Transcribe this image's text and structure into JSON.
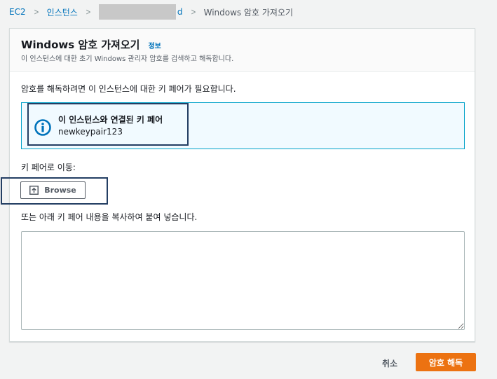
{
  "breadcrumb": {
    "items": [
      "EC2",
      "인스턴스"
    ],
    "redacted_tail": "d",
    "current": "Windows 암호 가져오기"
  },
  "panel": {
    "title": "Windows 암호 가져오기",
    "info_link": "정보",
    "description": "이 인스턴스에 대한 초기 Windows 관리자 암호를 검색하고 해독합니다.",
    "intro_text": "암호를 해독하려면 이 인스턴스에 대한 키 페어가 필요합니다."
  },
  "alert": {
    "icon": "info-icon",
    "title": "이 인스턴스와 연결된 키 페어",
    "value": "newkeypair123"
  },
  "key_file": {
    "label": "키 페어로 이동:",
    "browse_label": "Browse",
    "browse_icon": "upload-icon"
  },
  "paste": {
    "label": "또는 아래 키 페어 내용을 복사하여 붙여 넣습니다.",
    "value": ""
  },
  "actions": {
    "cancel_label": "취소",
    "decrypt_label": "암호 해독"
  },
  "colors": {
    "link": "#0073bb",
    "primary": "#ec7211",
    "alert_border": "#00a1c9",
    "alert_bg": "#f1faff",
    "highlight_box": "#233e63"
  }
}
